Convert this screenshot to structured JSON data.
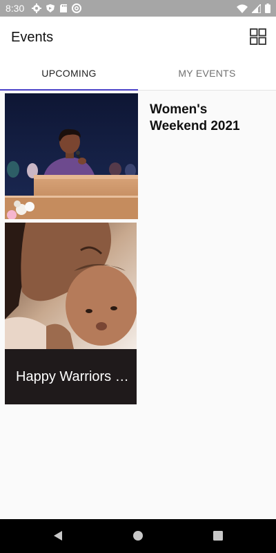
{
  "status_bar": {
    "time": "8:30",
    "left_icons": [
      "gear-icon",
      "shield-icon",
      "sd-card-icon",
      "at-sign-icon"
    ],
    "right_icons": [
      "wifi-icon",
      "signal-icon",
      "battery-icon"
    ]
  },
  "app_bar": {
    "title": "Events",
    "view_toggle_icon": "grid-view-icon"
  },
  "tabs": [
    {
      "label": "UPCOMING",
      "active": true
    },
    {
      "label": "MY EVENTS",
      "active": false
    }
  ],
  "accent_color": "#4a40c8",
  "events": [
    {
      "title": "Women's Weekend 2021",
      "image": "woman-speaking-at-podium"
    },
    {
      "title": "Happy Warriors …",
      "image": "mother-kissing-baby"
    }
  ],
  "nav_bar": {
    "icons": [
      "back-icon",
      "home-icon",
      "recents-icon"
    ]
  }
}
